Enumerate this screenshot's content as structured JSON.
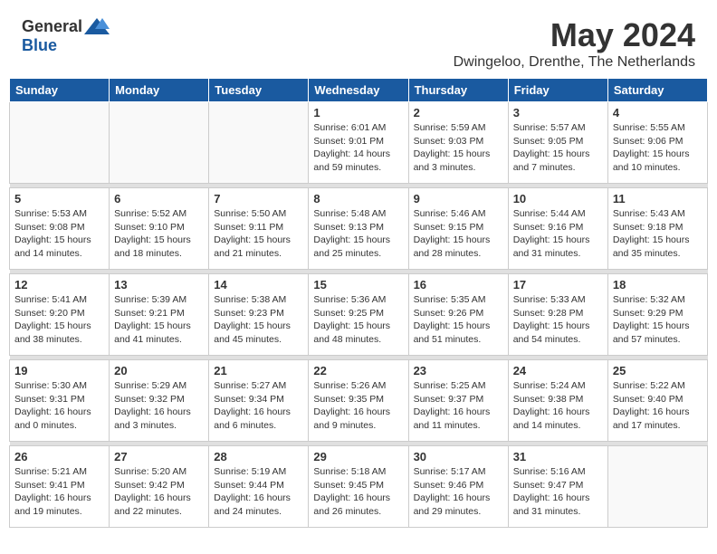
{
  "header": {
    "logo_general": "General",
    "logo_blue": "Blue",
    "month_title": "May 2024",
    "location": "Dwingeloo, Drenthe, The Netherlands"
  },
  "weekdays": [
    "Sunday",
    "Monday",
    "Tuesday",
    "Wednesday",
    "Thursday",
    "Friday",
    "Saturday"
  ],
  "weeks": [
    [
      {
        "day": "",
        "detail": ""
      },
      {
        "day": "",
        "detail": ""
      },
      {
        "day": "",
        "detail": ""
      },
      {
        "day": "1",
        "detail": "Sunrise: 6:01 AM\nSunset: 9:01 PM\nDaylight: 14 hours\nand 59 minutes."
      },
      {
        "day": "2",
        "detail": "Sunrise: 5:59 AM\nSunset: 9:03 PM\nDaylight: 15 hours\nand 3 minutes."
      },
      {
        "day": "3",
        "detail": "Sunrise: 5:57 AM\nSunset: 9:05 PM\nDaylight: 15 hours\nand 7 minutes."
      },
      {
        "day": "4",
        "detail": "Sunrise: 5:55 AM\nSunset: 9:06 PM\nDaylight: 15 hours\nand 10 minutes."
      }
    ],
    [
      {
        "day": "5",
        "detail": "Sunrise: 5:53 AM\nSunset: 9:08 PM\nDaylight: 15 hours\nand 14 minutes."
      },
      {
        "day": "6",
        "detail": "Sunrise: 5:52 AM\nSunset: 9:10 PM\nDaylight: 15 hours\nand 18 minutes."
      },
      {
        "day": "7",
        "detail": "Sunrise: 5:50 AM\nSunset: 9:11 PM\nDaylight: 15 hours\nand 21 minutes."
      },
      {
        "day": "8",
        "detail": "Sunrise: 5:48 AM\nSunset: 9:13 PM\nDaylight: 15 hours\nand 25 minutes."
      },
      {
        "day": "9",
        "detail": "Sunrise: 5:46 AM\nSunset: 9:15 PM\nDaylight: 15 hours\nand 28 minutes."
      },
      {
        "day": "10",
        "detail": "Sunrise: 5:44 AM\nSunset: 9:16 PM\nDaylight: 15 hours\nand 31 minutes."
      },
      {
        "day": "11",
        "detail": "Sunrise: 5:43 AM\nSunset: 9:18 PM\nDaylight: 15 hours\nand 35 minutes."
      }
    ],
    [
      {
        "day": "12",
        "detail": "Sunrise: 5:41 AM\nSunset: 9:20 PM\nDaylight: 15 hours\nand 38 minutes."
      },
      {
        "day": "13",
        "detail": "Sunrise: 5:39 AM\nSunset: 9:21 PM\nDaylight: 15 hours\nand 41 minutes."
      },
      {
        "day": "14",
        "detail": "Sunrise: 5:38 AM\nSunset: 9:23 PM\nDaylight: 15 hours\nand 45 minutes."
      },
      {
        "day": "15",
        "detail": "Sunrise: 5:36 AM\nSunset: 9:25 PM\nDaylight: 15 hours\nand 48 minutes."
      },
      {
        "day": "16",
        "detail": "Sunrise: 5:35 AM\nSunset: 9:26 PM\nDaylight: 15 hours\nand 51 minutes."
      },
      {
        "day": "17",
        "detail": "Sunrise: 5:33 AM\nSunset: 9:28 PM\nDaylight: 15 hours\nand 54 minutes."
      },
      {
        "day": "18",
        "detail": "Sunrise: 5:32 AM\nSunset: 9:29 PM\nDaylight: 15 hours\nand 57 minutes."
      }
    ],
    [
      {
        "day": "19",
        "detail": "Sunrise: 5:30 AM\nSunset: 9:31 PM\nDaylight: 16 hours\nand 0 minutes."
      },
      {
        "day": "20",
        "detail": "Sunrise: 5:29 AM\nSunset: 9:32 PM\nDaylight: 16 hours\nand 3 minutes."
      },
      {
        "day": "21",
        "detail": "Sunrise: 5:27 AM\nSunset: 9:34 PM\nDaylight: 16 hours\nand 6 minutes."
      },
      {
        "day": "22",
        "detail": "Sunrise: 5:26 AM\nSunset: 9:35 PM\nDaylight: 16 hours\nand 9 minutes."
      },
      {
        "day": "23",
        "detail": "Sunrise: 5:25 AM\nSunset: 9:37 PM\nDaylight: 16 hours\nand 11 minutes."
      },
      {
        "day": "24",
        "detail": "Sunrise: 5:24 AM\nSunset: 9:38 PM\nDaylight: 16 hours\nand 14 minutes."
      },
      {
        "day": "25",
        "detail": "Sunrise: 5:22 AM\nSunset: 9:40 PM\nDaylight: 16 hours\nand 17 minutes."
      }
    ],
    [
      {
        "day": "26",
        "detail": "Sunrise: 5:21 AM\nSunset: 9:41 PM\nDaylight: 16 hours\nand 19 minutes."
      },
      {
        "day": "27",
        "detail": "Sunrise: 5:20 AM\nSunset: 9:42 PM\nDaylight: 16 hours\nand 22 minutes."
      },
      {
        "day": "28",
        "detail": "Sunrise: 5:19 AM\nSunset: 9:44 PM\nDaylight: 16 hours\nand 24 minutes."
      },
      {
        "day": "29",
        "detail": "Sunrise: 5:18 AM\nSunset: 9:45 PM\nDaylight: 16 hours\nand 26 minutes."
      },
      {
        "day": "30",
        "detail": "Sunrise: 5:17 AM\nSunset: 9:46 PM\nDaylight: 16 hours\nand 29 minutes."
      },
      {
        "day": "31",
        "detail": "Sunrise: 5:16 AM\nSunset: 9:47 PM\nDaylight: 16 hours\nand 31 minutes."
      },
      {
        "day": "",
        "detail": ""
      }
    ]
  ]
}
